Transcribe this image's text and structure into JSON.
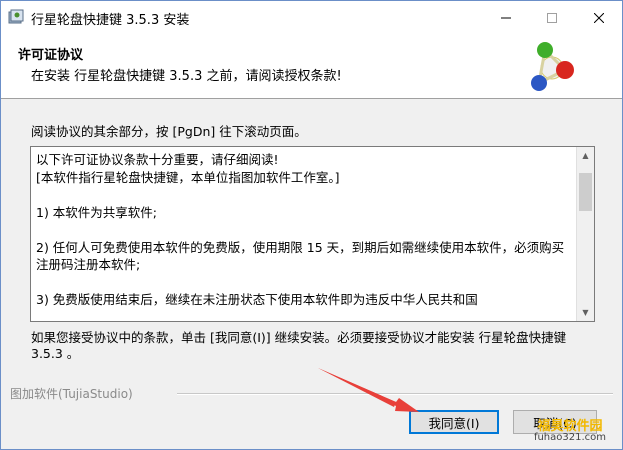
{
  "window": {
    "title": "行星轮盘快捷键 3.5.3 安装"
  },
  "header": {
    "title": "许可证协议",
    "subtitle": "在安装 行星轮盘快捷键 3.5.3 之前，请阅读授权条款!"
  },
  "instruction": "阅读协议的其余部分，按 [PgDn] 往下滚动页面。",
  "license": {
    "text": "以下许可证协议条款十分重要，请仔细阅读!\n[本软件指行星轮盘快捷键，本单位指图加软件工作室。]\n\n1) 本软件为共享软件;\n\n2) 任何人可免费使用本软件的免费版，使用期限 15 天，到期后如需继续使用本软件，必须购买注册码注册本软件;\n\n3) 免费版使用结束后，继续在未注册状态下使用本软件即为违反中华人民共和国"
  },
  "accept_text": "如果您接受协议中的条款，单击 [我同意(I)] 继续安装。必须要接受协议才能安装 行星轮盘快捷键 3.5.3 。",
  "branding": "图加软件(TujiaStudio)",
  "buttons": {
    "agree": "我同意(I)",
    "cancel": "取消(C)"
  },
  "watermark": {
    "line1": "福昊软件园",
    "line2": "fuhao321.com"
  },
  "icons": {
    "app": "installer-app-icon",
    "logo": "planet-wheel-logo",
    "minimize": "minimize-icon",
    "maximize": "maximize-icon",
    "close": "close-icon"
  },
  "colors": {
    "accent": "#0078d7",
    "arrow": "#e8403a",
    "watermark": "#f2b800"
  }
}
